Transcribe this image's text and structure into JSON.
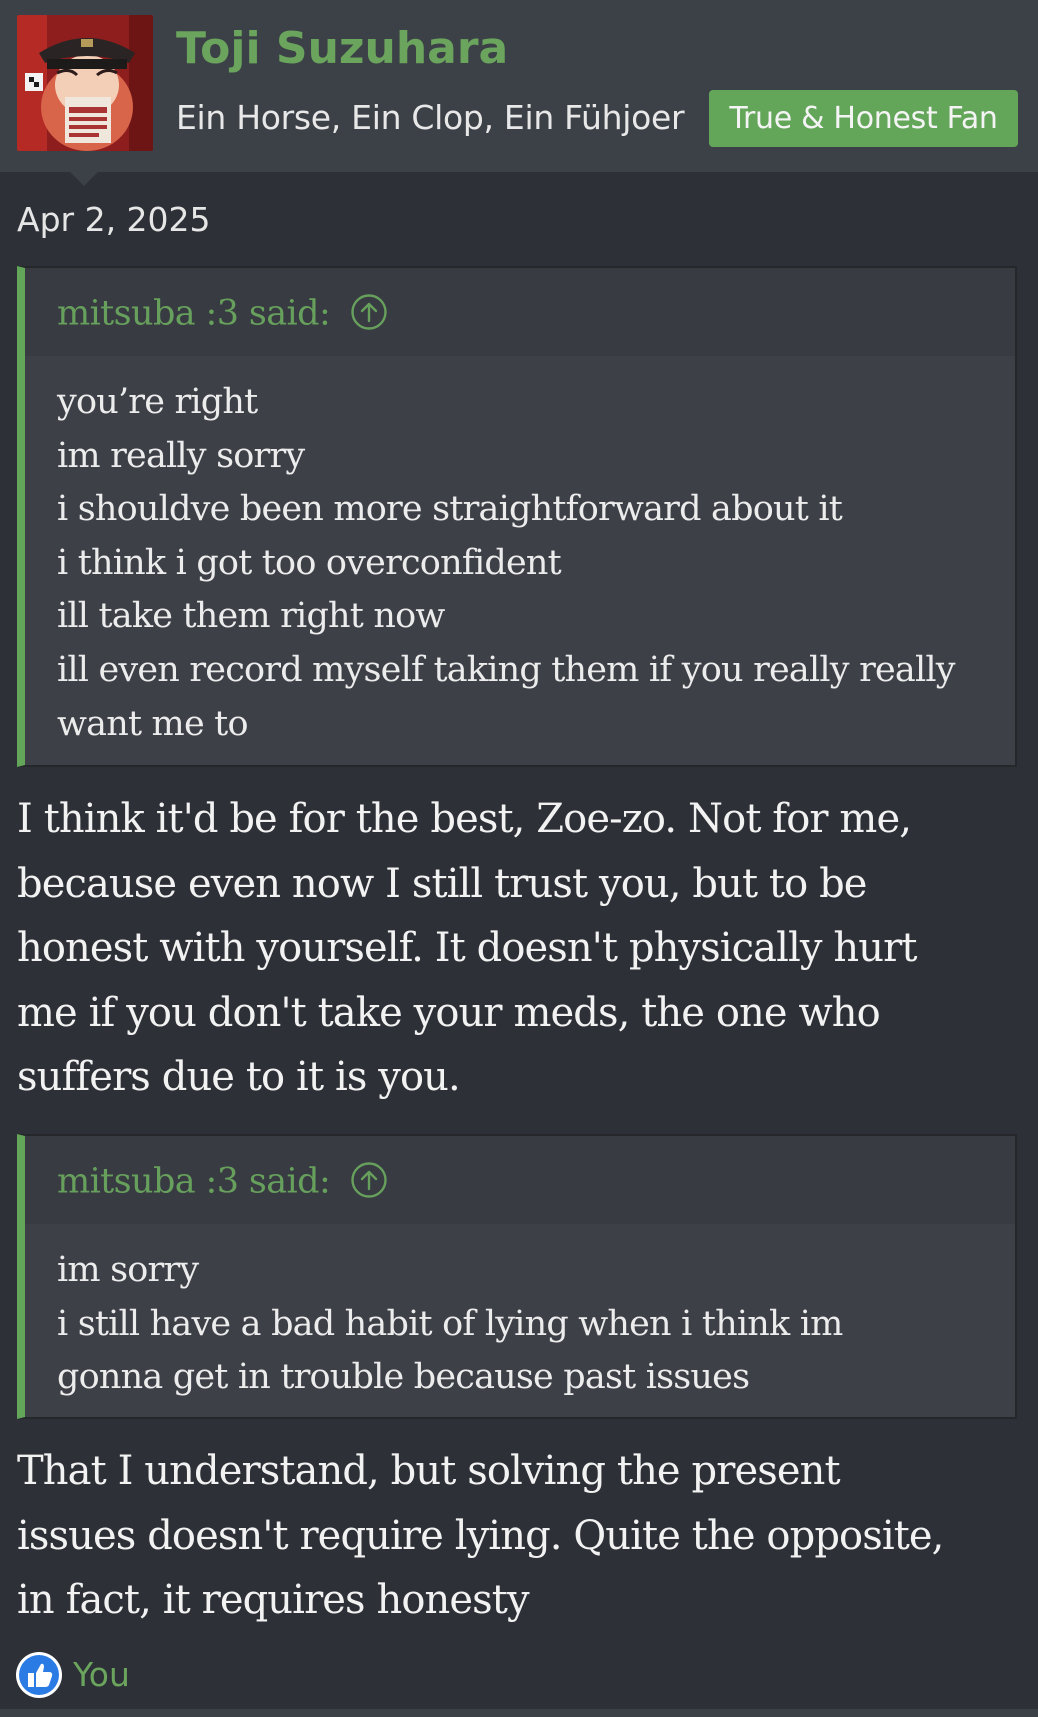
{
  "post": {
    "author": {
      "username": "Toji Suzuhara",
      "user_title": "Ein Horse, Ein Clop, Ein Fühjoer",
      "banner": "True & Honest Fan",
      "avatar_icon": "avatar-image",
      "colors": {
        "username": "#6aa45d",
        "banner_bg": "#63a65a"
      }
    },
    "date": "Apr 2, 2025",
    "quotes": [
      {
        "attribution": "mitsuba :3 said:",
        "jump_icon": "arrow-up-circle-icon",
        "lines": [
          "you’re right",
          "im really sorry",
          "i shouldve been more straightforward about it",
          "i think i got too overconfident",
          "ill take them right now",
          "ill even record myself taking them if you really really",
          "want me to"
        ]
      },
      {
        "attribution": "mitsuba :3 said:",
        "jump_icon": "arrow-up-circle-icon",
        "lines": [
          "im sorry",
          "i still have a bad habit of lying when i think im",
          "gonna get in trouble because past issues"
        ]
      }
    ],
    "messages": [
      {
        "lines": [
          "I think it'd be for the best, Zoe-zo. Not for me,",
          "because even now I still trust you, but to be",
          "honest with yourself. It doesn't physically hurt",
          "me if you don't take your meds, the one who",
          "suffers due to it is you."
        ]
      },
      {
        "lines": [
          "That I understand, but solving the present",
          "issues doesn't require lying. Quite the opposite,",
          "in fact, it requires honesty"
        ]
      }
    ],
    "reactions": {
      "icon": "thumbs-up-icon",
      "reactors": "You"
    }
  }
}
